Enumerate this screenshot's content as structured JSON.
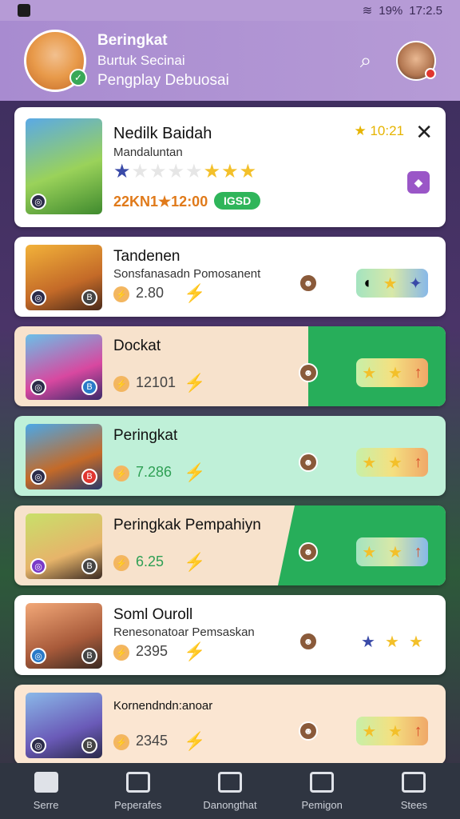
{
  "status_bar": {
    "battery": "19%",
    "time": "17:2.5"
  },
  "header": {
    "title": "Beringkat",
    "subtitle": "Burtuk Secinai",
    "subtitle2": "Pengplay Debuosai",
    "search_icon": "search-icon"
  },
  "featured": {
    "title": "Nedilk Baidah",
    "subtitle": "Mandaluntan",
    "rating": "10:21",
    "score": "22KN1★12:00",
    "pill": "IGSD",
    "stars": {
      "blue": 1,
      "empty": 4,
      "gold": 3
    }
  },
  "rows": [
    {
      "title": "Tandenen",
      "subtitle": "Sonsfanasadn Pomosanent",
      "points": "2.80"
    },
    {
      "title": "Dockat",
      "subtitle": "",
      "points": "12101"
    },
    {
      "title": "Peringkat",
      "subtitle": "",
      "points": "7.286"
    },
    {
      "title": "Peringkak Pempahiyn",
      "subtitle": "",
      "points": "6.25"
    },
    {
      "title": "Soml Ouroll",
      "subtitle": "Renesonatoar Pemsaskan",
      "points": "2395"
    },
    {
      "title": "Kornendndn:anoar",
      "subtitle": "",
      "points": "2345"
    }
  ],
  "nav": [
    {
      "label": "Serre",
      "icon": "home-icon"
    },
    {
      "label": "Peperafes",
      "icon": "tasks-icon"
    },
    {
      "label": "Danongthat",
      "icon": "stats-icon"
    },
    {
      "label": "Pemigon",
      "icon": "media-icon"
    },
    {
      "label": "Stees",
      "icon": "settings-icon"
    }
  ]
}
